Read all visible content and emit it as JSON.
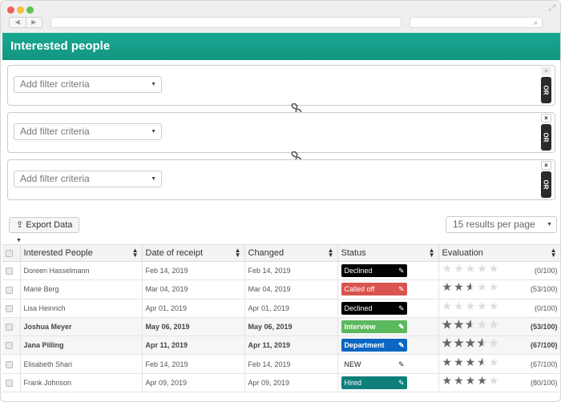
{
  "page": {
    "title": "Interested people"
  },
  "filters": [
    {
      "placeholder": "Add filter criteria",
      "or_label": "OR",
      "close": "×"
    },
    {
      "placeholder": "Add filter criteria",
      "or_label": "OR",
      "close": "×"
    },
    {
      "placeholder": "Add filter criteria",
      "or_label": "OR",
      "close": "×"
    }
  ],
  "toolbar": {
    "export_label": "Export Data",
    "results_per_page": "15 results per page"
  },
  "table": {
    "columns": [
      "Interested People",
      "Date of receipt",
      "Changed",
      "Status",
      "Evaluation"
    ],
    "rows": [
      {
        "name": "Doreen Hasselmann",
        "received": "Feb 14, 2019",
        "changed": "Feb 14, 2019",
        "status": "Declined",
        "status_color": "#000000",
        "stars": 0,
        "score": "(0/100)",
        "bold": false
      },
      {
        "name": "Marie Berg",
        "received": "Mar 04, 2019",
        "changed": "Mar 04, 2019",
        "status": "Called off",
        "status_color": "#d9534f",
        "stars": 2.5,
        "score": "(53/100)",
        "bold": false
      },
      {
        "name": "Lisa Heinrich",
        "received": "Apr 01, 2019",
        "changed": "Apr 01, 2019",
        "status": "Declined",
        "status_color": "#000000",
        "stars": 0,
        "score": "(0/100)",
        "bold": false
      },
      {
        "name": "Joshua Meyer",
        "received": "May 06, 2019",
        "changed": "May 06, 2019",
        "status": "Interview",
        "status_color": "#5cb85c",
        "stars": 2.5,
        "score": "(53/100)",
        "bold": true
      },
      {
        "name": "Jana Pilling",
        "received": "Apr 11, 2019",
        "changed": "Apr 11, 2019",
        "status": "Department",
        "status_color": "#0a66c2",
        "stars": 3.5,
        "score": "(67/100)",
        "bold": true
      },
      {
        "name": "Elisabeth Shari",
        "received": "Feb 14, 2019",
        "changed": "Feb 14, 2019",
        "status": "NEW",
        "status_color": "#ffffff",
        "stars": 3.5,
        "score": "(67/100)",
        "bold": false
      },
      {
        "name": "Frank Johnson",
        "received": "Apr 09, 2019",
        "changed": "Apr 09, 2019",
        "status": "Hired",
        "status_color": "#0e7f7a",
        "stars": 4,
        "score": "(80/100)",
        "bold": false
      }
    ]
  },
  "colors": {
    "accent": "#17a38e",
    "star_on": "#666666",
    "star_off": "#dddddd"
  },
  "icons": {
    "export": "upload-icon",
    "link": "link-icon",
    "pencil": "pencil-icon",
    "sort": "sort-icon"
  }
}
